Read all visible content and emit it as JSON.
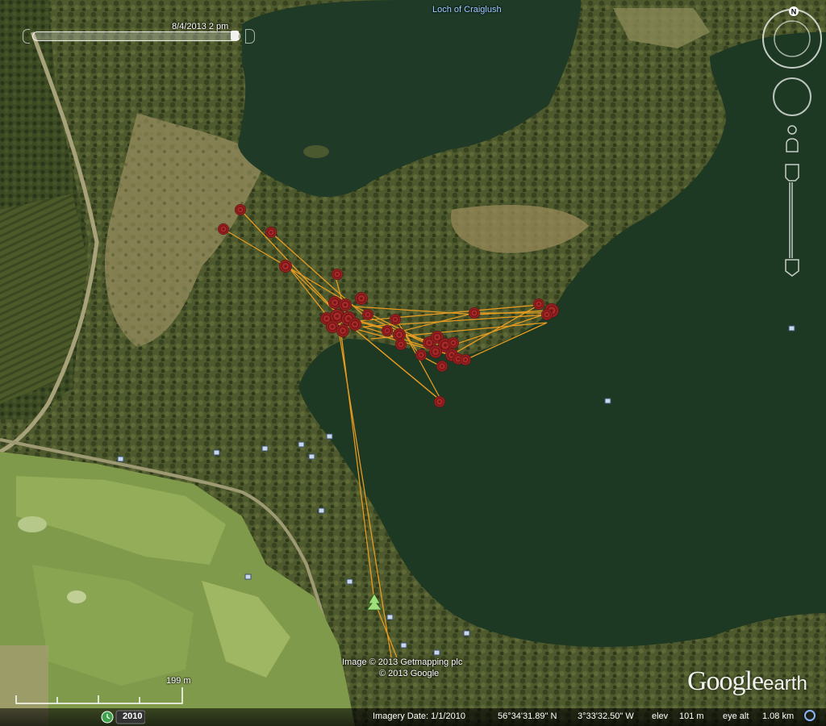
{
  "lake_label": "Loch of Craiglush",
  "time_slider": {
    "label": "8/4/2013  2 pm"
  },
  "credits": {
    "line1": "Image © 2013 Getmapping plc",
    "line2": "© 2013 Google"
  },
  "logo": {
    "brand": "Google",
    "product": "earth"
  },
  "scale": {
    "label": "199 m"
  },
  "historical_imagery": {
    "year": "2010"
  },
  "status": {
    "imagery_date": "Imagery Date: 1/1/2010",
    "lat": "56°34'31.89\" N",
    "lon": "3°33'32.50\" W",
    "elev_label": "elev",
    "elev_value": "101 m",
    "eye_label": "eye alt",
    "eye_value": "1.08 km"
  },
  "navigation": {
    "north_label": "N"
  },
  "colors": {
    "track": "#f0a020",
    "marker": "#8b1a1a",
    "marker_ring": "#d04040",
    "water": "#1f3a26"
  },
  "icons": {
    "compass": "compass-ring-icon",
    "look": "look-joystick-icon",
    "streetview": "pegman-icon",
    "zoom": "zoom-slider-icon",
    "tree": "tree-placemark-icon",
    "photo": "photo-placemark-icon"
  }
}
